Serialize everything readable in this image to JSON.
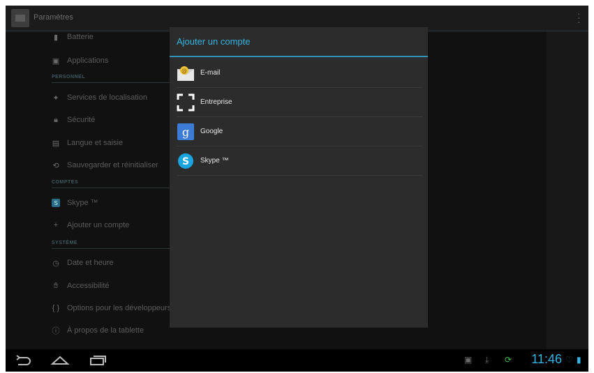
{
  "action_bar": {
    "title": "Paramètres"
  },
  "settings": {
    "items_top": [
      {
        "label": "Batterie",
        "icon": "battery-icon"
      },
      {
        "label": "Applications",
        "icon": "apps-icon"
      }
    ],
    "section_personnel": "PERSONNEL",
    "items_personnel": [
      {
        "label": "Services de localisation",
        "icon": "location-icon"
      },
      {
        "label": "Sécurité",
        "icon": "lock-icon"
      },
      {
        "label": "Langue et saisie",
        "icon": "keyboard-icon"
      },
      {
        "label": "Sauvegarder et réinitialiser",
        "icon": "backup-icon"
      }
    ],
    "section_comptes": "COMPTES",
    "items_comptes": [
      {
        "label": "Skype ™",
        "icon": "skype-icon"
      },
      {
        "label": "Ajouter un compte",
        "icon": "plus-icon"
      }
    ],
    "section_systeme": "SYSTÈME",
    "items_systeme": [
      {
        "label": "Date et heure",
        "icon": "clock-icon"
      },
      {
        "label": "Accessibilité",
        "icon": "hand-icon"
      },
      {
        "label": "Options pour les développeurs",
        "icon": "braces-icon"
      },
      {
        "label": "À propos de la tablette",
        "icon": "info-icon"
      }
    ]
  },
  "dialog": {
    "title": "Ajouter un compte",
    "options": [
      {
        "label": "E-mail",
        "icon": "email-icon"
      },
      {
        "label": "Entreprise",
        "icon": "corporate-icon"
      },
      {
        "label": "Google",
        "icon": "google-icon"
      },
      {
        "label": "Skype ™",
        "icon": "skype-icon"
      }
    ]
  },
  "nav_bar": {
    "buttons": [
      "back-icon",
      "home-icon",
      "recent-apps-icon"
    ],
    "status_icons": [
      "screenshot-icon",
      "download-icon",
      "sync-icon",
      "wifi-icon",
      "battery-icon"
    ],
    "clock": "11:46"
  },
  "colors": {
    "accent": "#33b5e5",
    "background": "#151515",
    "dialog": "#2c2c2c"
  }
}
